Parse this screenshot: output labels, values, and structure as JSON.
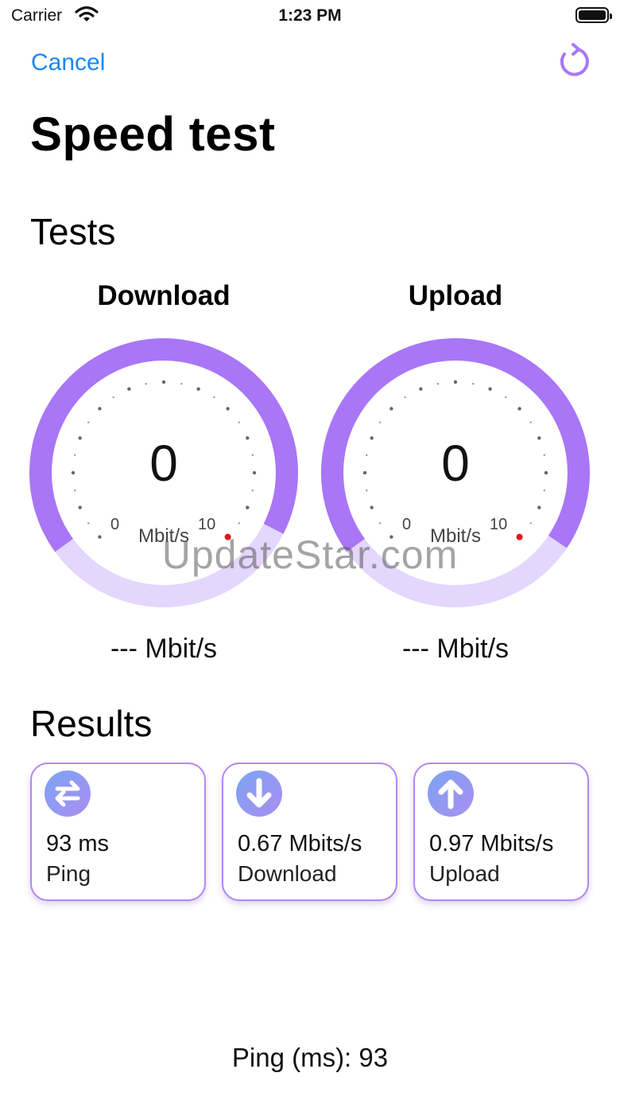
{
  "status_bar": {
    "carrier": "Carrier",
    "time": "1:23 PM"
  },
  "nav": {
    "cancel_label": "Cancel"
  },
  "page_title": "Speed test",
  "tests_title": "Tests",
  "gauges": [
    {
      "label": "Download",
      "value": "0",
      "min": "0",
      "max": "10",
      "unit": "Mbit/s",
      "speed": "--- Mbit/s"
    },
    {
      "label": "Upload",
      "value": "0",
      "min": "0",
      "max": "10",
      "unit": "Mbit/s",
      "speed": "--- Mbit/s"
    }
  ],
  "watermark": "UpdateStar.com",
  "results_title": "Results",
  "results": [
    {
      "icon": "swap-arrows-icon",
      "value": "93 ms",
      "label": "Ping"
    },
    {
      "icon": "download-arrow-icon",
      "value": "0.67 Mbits/s",
      "label": "Download"
    },
    {
      "icon": "upload-arrow-icon",
      "value": "0.97 Mbits/s",
      "label": "Upload"
    }
  ],
  "footer": {
    "ping_text": "Ping (ms): 93"
  },
  "colors": {
    "accent": "#a876f7",
    "accent_light": "#e4d6fc",
    "link": "#1a87f5",
    "needle_dot": "#e0141e"
  }
}
